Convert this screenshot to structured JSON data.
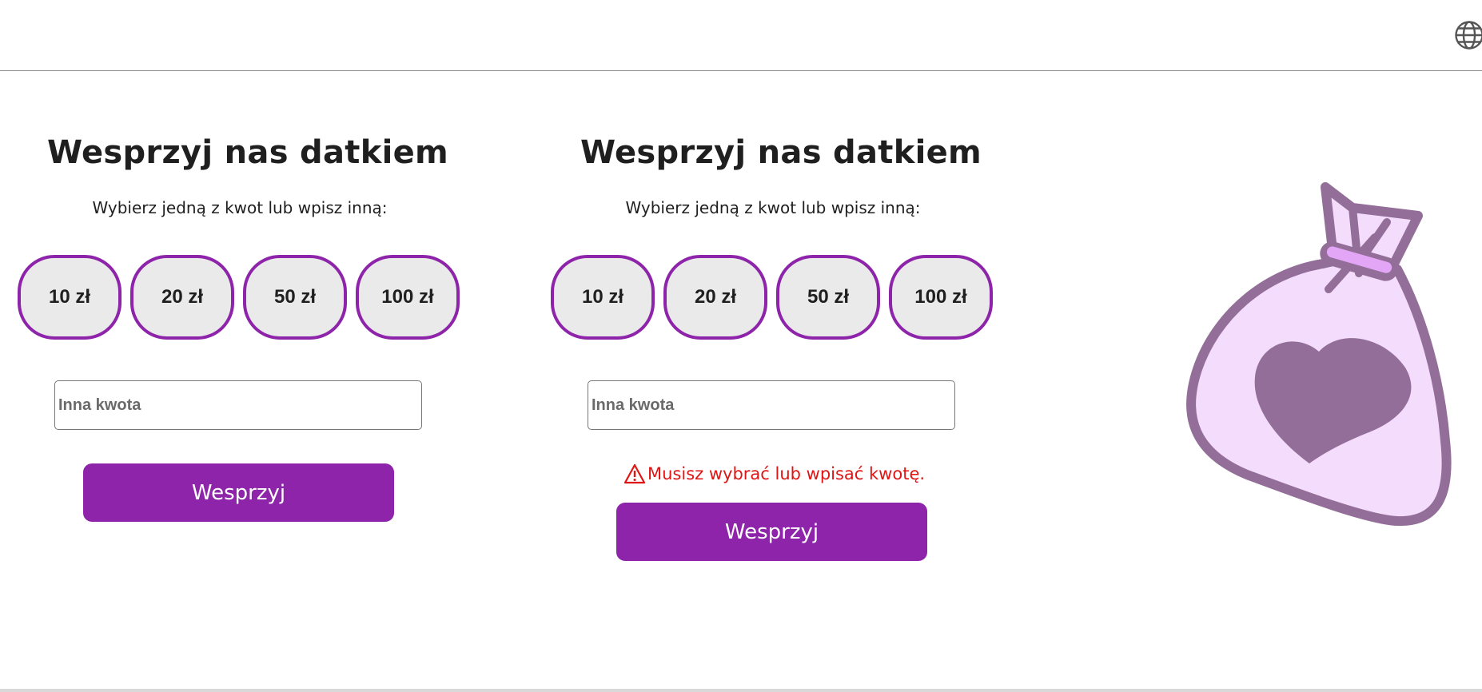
{
  "header": {
    "language_icon": "globe-icon"
  },
  "forms": [
    {
      "title": "Wesprzyj nas datkiem",
      "subtitle": "Wybierz jedną z kwot lub wpisz inną:",
      "amounts": [
        "10 zł",
        "20 zł",
        "50 zł",
        "100 zł"
      ],
      "other_amount": {
        "placeholder": "Inna kwota",
        "value": ""
      },
      "submit_label": "Wesprzyj"
    },
    {
      "title": "Wesprzyj nas datkiem",
      "subtitle": "Wybierz jedną z kwot lub wpisz inną:",
      "amounts": [
        "10 zł",
        "20 zł",
        "50 zł",
        "100 zł"
      ],
      "other_amount": {
        "placeholder": "Inna kwota",
        "value": ""
      },
      "error": "Musisz wybrać lub wpisać kwotę.",
      "error_icon": "warning-triangle-icon",
      "submit_label": "Wesprzyj"
    }
  ],
  "illustration": {
    "icon": "money-bag-heart-icon"
  },
  "colors": {
    "accent": "#8e24aa",
    "button_bg": "#eaeaea",
    "error": "#e01515",
    "bag_fill": "#f4dcfd",
    "bag_stroke": "#926e98"
  }
}
